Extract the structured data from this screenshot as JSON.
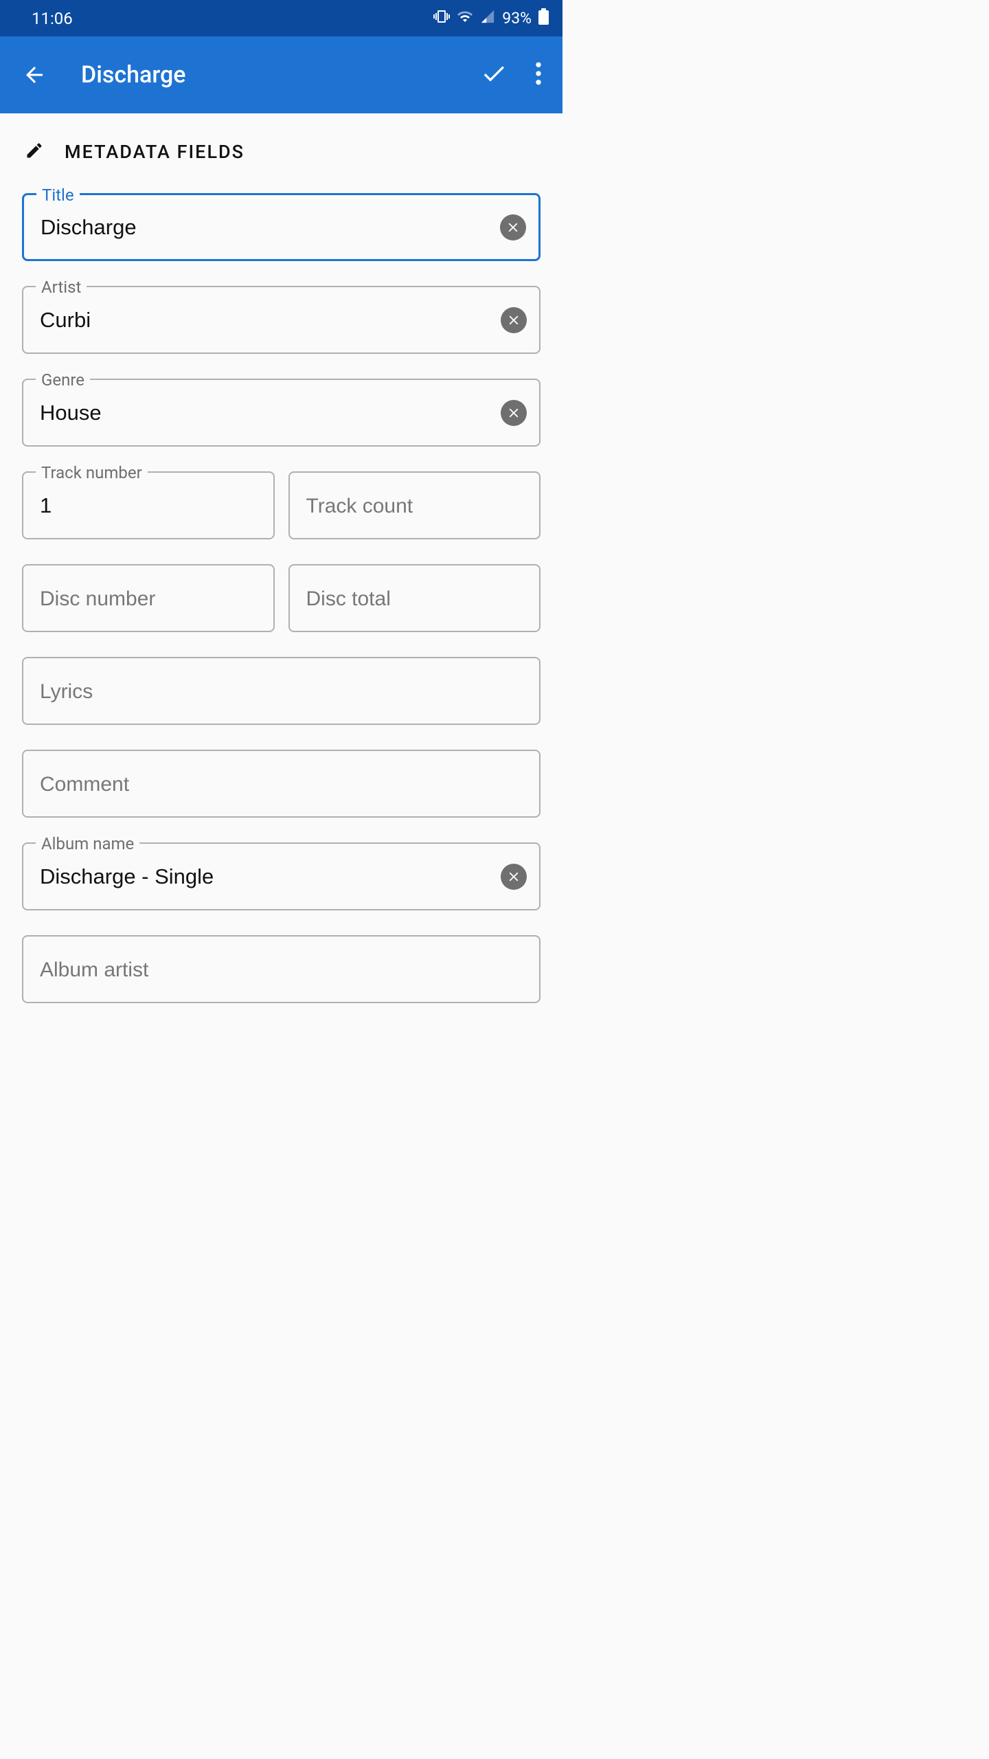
{
  "statusbar": {
    "time": "11:06",
    "battery": "93%"
  },
  "appbar": {
    "title": "Discharge"
  },
  "section": {
    "header": "METADATA FIELDS"
  },
  "fields": {
    "title": {
      "label": "Title",
      "value": "Discharge"
    },
    "artist": {
      "label": "Artist",
      "value": "Curbi"
    },
    "genre": {
      "label": "Genre",
      "value": "House"
    },
    "track_number": {
      "label": "Track number",
      "value": "1"
    },
    "track_count": {
      "placeholder": "Track count"
    },
    "disc_number": {
      "placeholder": "Disc number"
    },
    "disc_total": {
      "placeholder": "Disc total"
    },
    "lyrics": {
      "placeholder": "Lyrics"
    },
    "comment": {
      "placeholder": "Comment"
    },
    "album_name": {
      "label": "Album name",
      "value": "Discharge - Single"
    },
    "album_artist": {
      "placeholder": "Album artist"
    }
  }
}
